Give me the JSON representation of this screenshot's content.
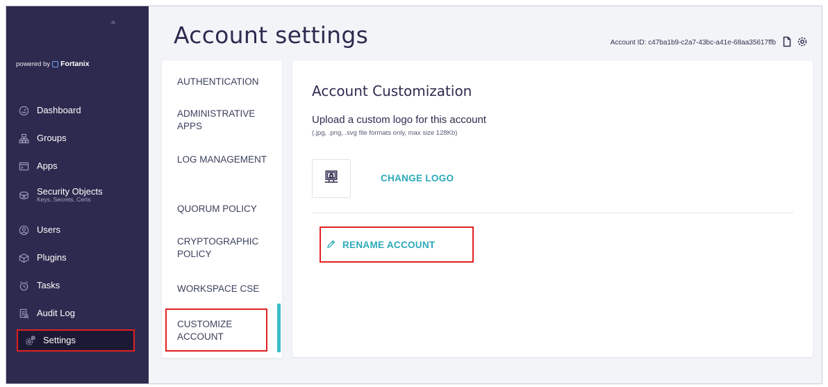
{
  "sidebar": {
    "powered_by": "powered by",
    "brand": "Fortanix",
    "items": [
      {
        "label": "Dashboard",
        "sub": "",
        "icon": "dashboard-icon"
      },
      {
        "label": "Groups",
        "sub": "",
        "icon": "groups-icon"
      },
      {
        "label": "Apps",
        "sub": "",
        "icon": "apps-icon"
      },
      {
        "label": "Security Objects",
        "sub": "Keys, Secrets, Certs",
        "icon": "security-objects-icon"
      },
      {
        "label": "Users",
        "sub": "",
        "icon": "users-icon"
      },
      {
        "label": "Plugins",
        "sub": "",
        "icon": "plugins-icon"
      },
      {
        "label": "Tasks",
        "sub": "",
        "icon": "tasks-icon"
      },
      {
        "label": "Audit Log",
        "sub": "",
        "icon": "audit-log-icon"
      },
      {
        "label": "Settings",
        "sub": "",
        "icon": "settings-icon"
      }
    ],
    "active": "Settings"
  },
  "header": {
    "title": "Account settings",
    "account_id": "Account ID: c47ba1b9-c2a7-43bc-a41e-68aa35617ffb"
  },
  "tabs": [
    "AUTHENTICATION",
    "ADMINISTRATIVE APPS",
    "LOG MANAGEMENT",
    "QUORUM POLICY",
    "CRYPTOGRAPHIC POLICY",
    "WORKSPACE CSE",
    "CUSTOMIZE ACCOUNT"
  ],
  "active_tab": "CUSTOMIZE ACCOUNT",
  "content": {
    "section_title": "Account Customization",
    "upload_title": "Upload a custom logo for this account",
    "upload_hint": "(.jpg, .png, .svg file formats only, max size 128Kb)",
    "change_logo_label": "CHANGE LOGO",
    "rename_label": "RENAME ACCOUNT"
  },
  "colors": {
    "sidebar_bg": "#2e2a4f",
    "accent": "#2aa9b9",
    "highlight_border": "#e02020"
  }
}
